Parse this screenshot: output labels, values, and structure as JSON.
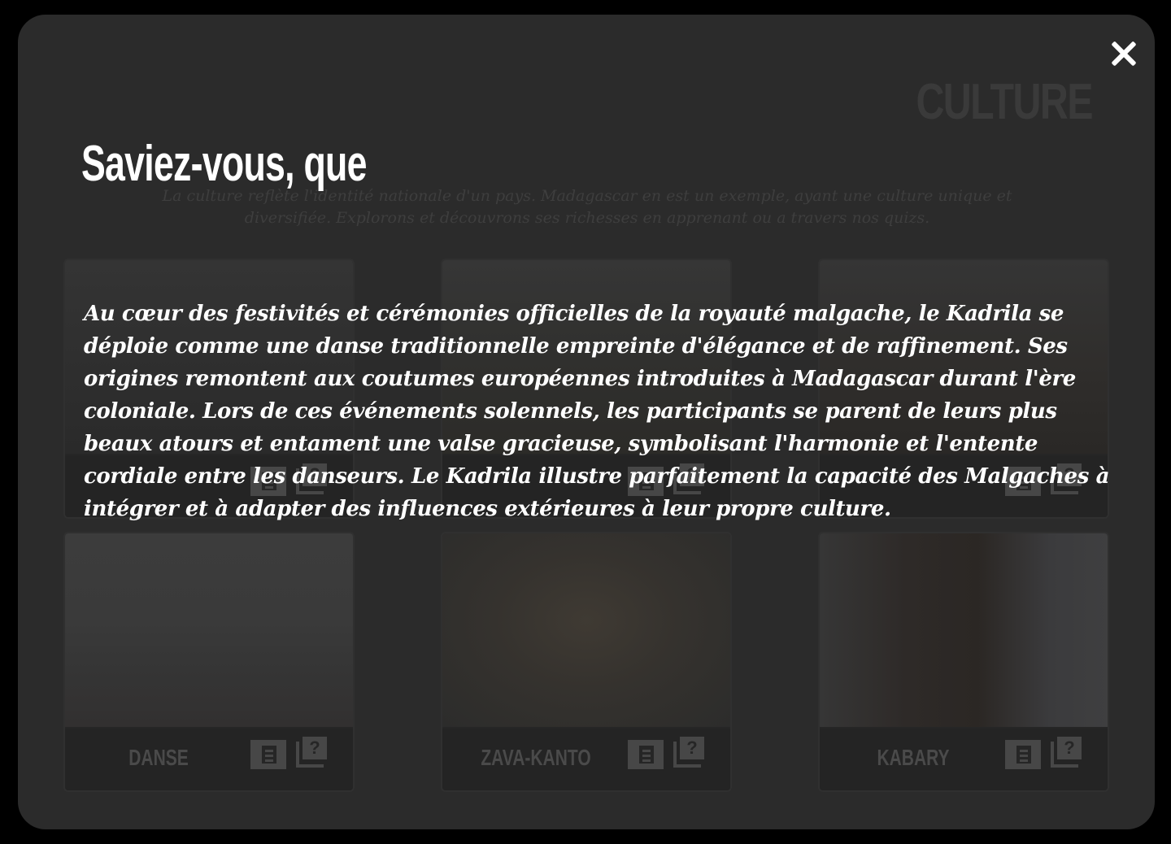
{
  "page": {
    "title": "CULTURE",
    "intro": "La culture reflète l'identité nationale d'un pays. Madagascar en est un exemple, ayant une culture unique et diversifiée. Explorons et découvrons ses richesses en apprenant ou a travers nos quizs."
  },
  "cards": [
    {
      "label": "",
      "icon_read": "book-icon",
      "icon_quiz": "quiz-icon"
    },
    {
      "label": "",
      "icon_read": "book-icon",
      "icon_quiz": "quiz-icon"
    },
    {
      "label": "",
      "icon_read": "book-icon",
      "icon_quiz": "quiz-icon"
    },
    {
      "label": "DANSE",
      "icon_read": "book-icon",
      "icon_quiz": "quiz-icon"
    },
    {
      "label": "ZAVA-KANTO",
      "icon_read": "book-icon",
      "icon_quiz": "quiz-icon"
    },
    {
      "label": "KABARY",
      "icon_read": "book-icon",
      "icon_quiz": "quiz-icon"
    }
  ],
  "modal": {
    "title": "Saviez-vous, que",
    "text": "Au cœur des festivités et cérémonies officielles de la royauté malgache, le Kadrila se déploie comme une danse traditionnelle empreinte d'élégance et de raffinement. Ses origines remontent aux coutumes européennes introduites à Madagascar durant l'ère coloniale. Lors de ces événements solennels, les participants se parent de leurs plus beaux atours et entament une valse gracieuse, symbolisant l'harmonie et l'entente cordiale entre les danseurs. Le Kadrila illustre parfaitement la capacité des Malgaches à intégrer et à adapter des influences extérieures à leur propre culture.",
    "close_icon": "close-icon"
  },
  "colors": {
    "backdrop": "#000000",
    "panel": "#2b2b2b",
    "modal_text": "#ffffff"
  }
}
